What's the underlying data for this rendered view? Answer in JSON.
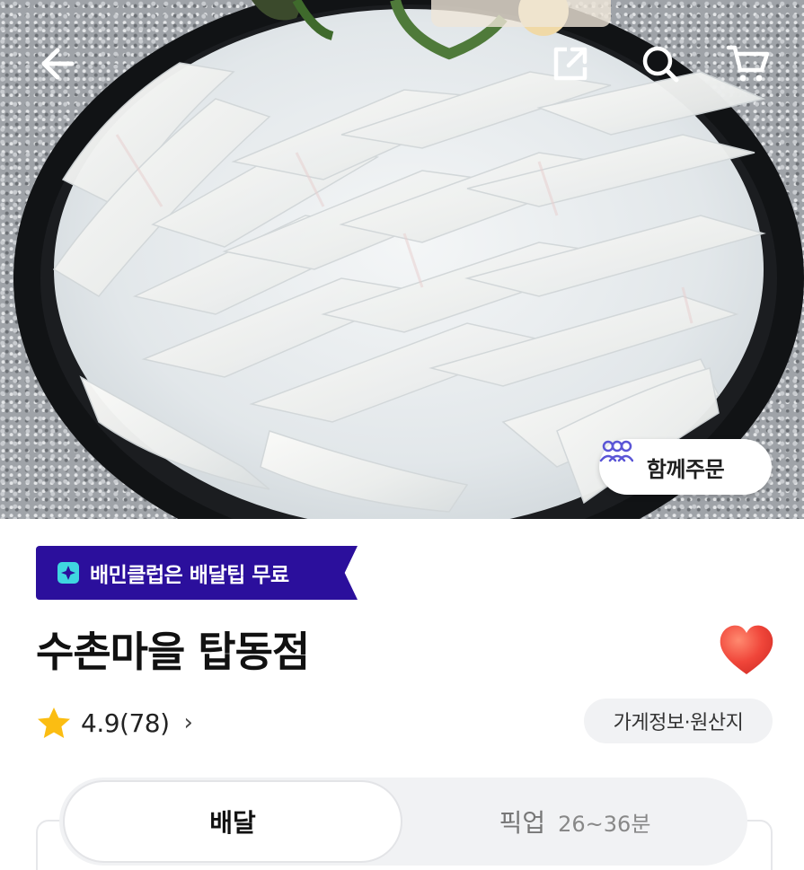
{
  "header": {
    "back_icon": "arrow-left-icon",
    "share_icon": "share-external-icon",
    "search_icon": "search-icon",
    "cart_icon": "cart-icon"
  },
  "hero": {
    "group_order_label": "함께주문",
    "group_order_icon": "people-icon"
  },
  "club_banner": {
    "icon": "baemin-club-icon",
    "label": "배민클럽은 배달팁 무료",
    "color": "#2b0f9c"
  },
  "store": {
    "name": "수촌마을 탑동점",
    "favorite_icon": "heart-icon",
    "heart_color": "#f0463a"
  },
  "rating": {
    "icon": "star-icon",
    "text": "4.9(78)",
    "chevron": "›"
  },
  "info_button": {
    "label": "가게정보·원산지"
  },
  "order_tabs": {
    "delivery_label": "배달",
    "pickup_label": "픽업",
    "pickup_time": "26~36분"
  }
}
